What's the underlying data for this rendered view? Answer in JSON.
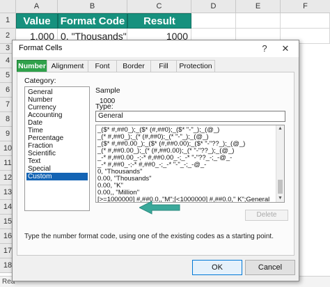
{
  "sheet": {
    "columns": [
      "A",
      "B",
      "C",
      "D",
      "E",
      "F"
    ],
    "rows": [
      "1",
      "2",
      "3",
      "4",
      "5",
      "6",
      "7",
      "8",
      "9",
      "10",
      "11",
      "12",
      "13",
      "14",
      "15",
      "16",
      "17",
      "18"
    ],
    "headers": {
      "a1": "Value",
      "b1": "Format Code",
      "c1": "Result"
    },
    "row2": {
      "a2": "1,000",
      "b2": "0, \"Thousands\"",
      "c2": "1000"
    },
    "status_text": "Rea",
    "accent_color": "#17917e"
  },
  "dialog": {
    "title": "Format Cells",
    "help_glyph": "?",
    "close_glyph": "✕",
    "tabs": [
      "Number",
      "Alignment",
      "Font",
      "Border",
      "Fill",
      "Protection"
    ],
    "active_tab": "Number",
    "category_label": "Category:",
    "categories": [
      "General",
      "Number",
      "Currency",
      "Accounting",
      "Date",
      "Time",
      "Percentage",
      "Fraction",
      "Scientific",
      "Text",
      "Special",
      "Custom"
    ],
    "selected_category": "Custom",
    "sample_label": "Sample",
    "sample_value": "1000",
    "type_label": "Type:",
    "type_value": "General",
    "formats": [
      "_($* #,##0_);_($* (#,##0);_($* \"-\"_);_(@_)",
      "_(* #,##0_);_(* (#,##0);_(* \"-\"_);_(@_)",
      "_($* #,##0.00_);_($* (#,##0.00);_($* \"-\"??_);_(@_)",
      "_(* #,##0.00_);_(* (#,##0.00);_(* \"-\"??_);_(@_)",
      "_-* #,##0.00_-;-* #,##0.00_-;_-* \"-\"??_-;_-@_-",
      "_-* #,##0_-;-* #,##0_-;_-* \"-\"_-;_-@_-",
      "0, \"Thousands\"",
      "0.00, \"Thousands\"",
      "0.00, \"K\"",
      "0.00,, \"Million\"",
      "[>=1000000] #,##0.0,,\"M\";[<1000000] #,##0.0,\" K\";General"
    ],
    "delete_label": "Delete",
    "hint": "Type the number format code, using one of the existing codes as a starting point.",
    "ok_label": "OK",
    "cancel_label": "Cancel",
    "tab_active_color": "#2fa14a",
    "arrow_color": "#3aa89a"
  }
}
